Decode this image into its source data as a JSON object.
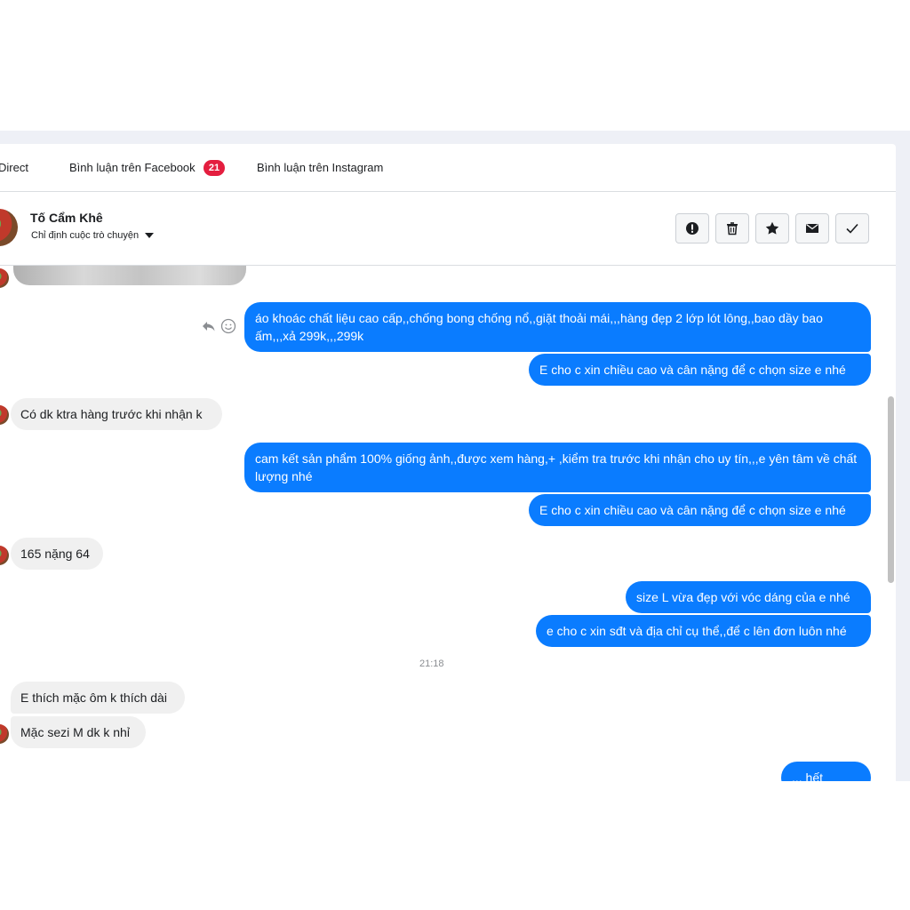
{
  "tabs": [
    {
      "label": "Direct"
    },
    {
      "label": "Bình luận trên Facebook",
      "badge": "21"
    },
    {
      "label": "Bình luận trên Instagram"
    }
  ],
  "header": {
    "contact_name": "Tố Cẩm Khê",
    "assign_label": "Chỉ định cuộc trò chuyện",
    "actions": [
      "report-icon",
      "trash-icon",
      "star-icon",
      "mail-icon",
      "check-icon"
    ]
  },
  "messages": [
    {
      "dir": "out",
      "text": "áo khoác chất liệu  cao cấp,,chống bong chống nổ,,giặt thoải mái,,,hàng đẹp 2 lớp lót lông,,bao dầy bao ấm,,,xả 299k,,,299k"
    },
    {
      "dir": "out",
      "text": "E cho c xin chiều cao và cân nặng để c chọn size e nhé"
    },
    {
      "dir": "in",
      "text": "Có dk ktra hàng trước khi nhận k"
    },
    {
      "dir": "out",
      "text": "cam kết sản phẩm 100% giống ảnh,,được xem hàng,+ ,kiểm tra trước khi nhận cho uy tín,,,e yên tâm về chất lượng nhé"
    },
    {
      "dir": "out",
      "text": "E cho c xin chiều cao và cân nặng để c chọn size e nhé"
    },
    {
      "dir": "in",
      "text": "165 nặng 64"
    },
    {
      "dir": "out",
      "text": "size L vừa đẹp với vóc dáng của e nhé"
    },
    {
      "dir": "out",
      "text": "e cho c xin sđt và địa chỉ cụ thể,,để c lên đơn luôn nhé"
    },
    {
      "dir": "in",
      "text": "E thích mặc ôm k thích dài"
    },
    {
      "dir": "in",
      "text": "Mặc sezi M dk k nhỉ"
    },
    {
      "dir": "out",
      "text": "... hết"
    }
  ],
  "timestamp": "21:18",
  "colors": {
    "outgoing": "#0a7cff",
    "incoming": "#f0f0f0",
    "badge": "#e41e3f"
  }
}
